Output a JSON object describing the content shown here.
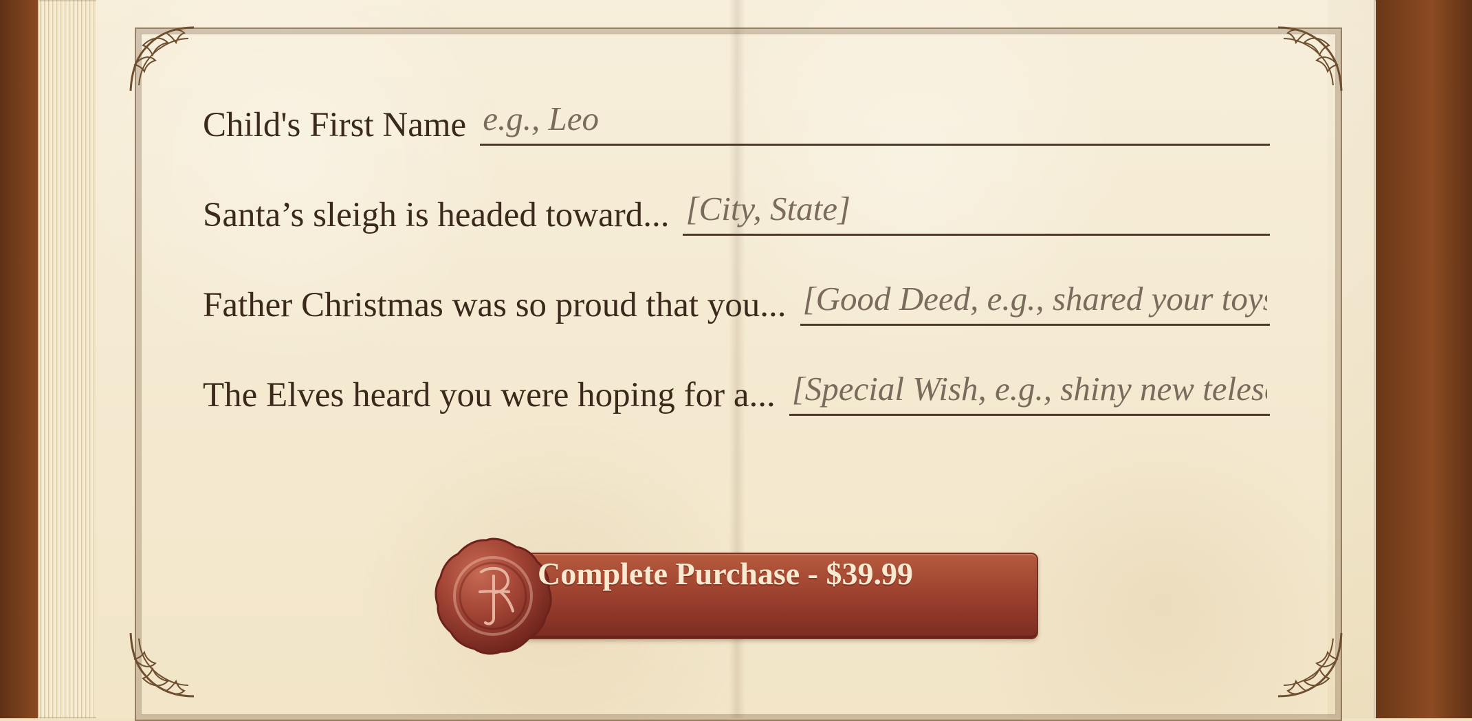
{
  "form": {
    "fields": [
      {
        "label": "Child's First Name",
        "placeholder": "e.g., Leo"
      },
      {
        "label": "Santa’s sleigh is headed toward...",
        "placeholder": "[City, State]"
      },
      {
        "label": "Father Christmas was so proud that you...",
        "placeholder": "[Good Deed, e.g., shared your toys]"
      },
      {
        "label": "The Elves heard you were hoping for a...",
        "placeholder": "[Special Wish, e.g., shiny new telescope]"
      }
    ]
  },
  "cta": {
    "label": "Complete Purchase - $39.99",
    "seal_icon": "wax-seal-icon"
  },
  "theme": {
    "parchment": "#f4ead2",
    "ink": "#3b2a1b",
    "placeholder": "#7a6b5d",
    "button": "#9b3f2e",
    "button_text": "#f8ead1",
    "leather": "#8b4b22"
  }
}
